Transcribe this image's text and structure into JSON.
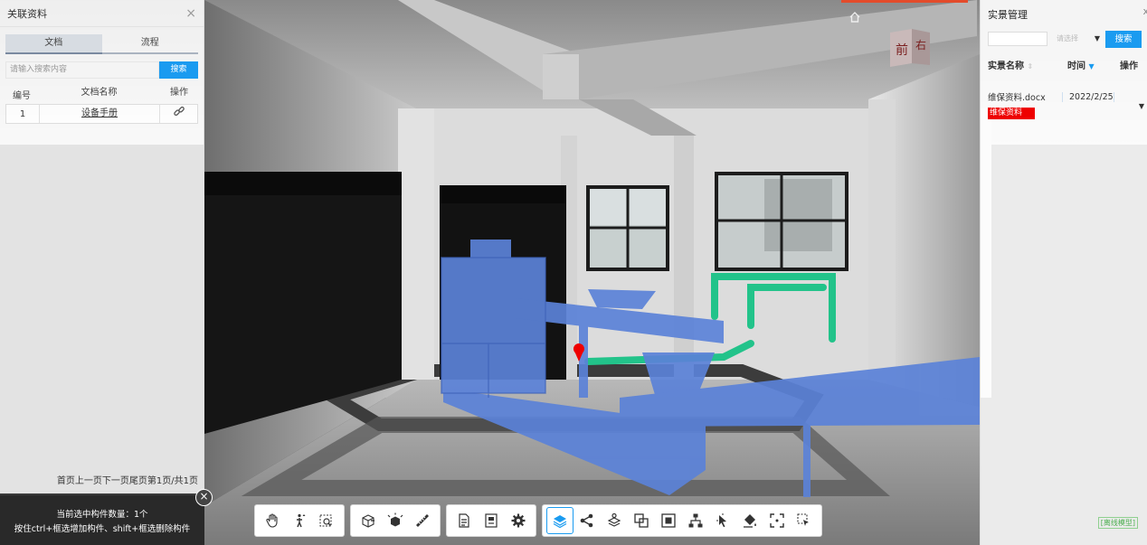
{
  "left_panel": {
    "title": "关联资料",
    "close": "×",
    "tabs": [
      {
        "label": "文档",
        "active": true
      },
      {
        "label": "流程",
        "active": false
      }
    ],
    "search": {
      "placeholder": "请输入搜索内容",
      "button": "搜索"
    },
    "table": {
      "headers": [
        "编号",
        "文档名称",
        "操作"
      ],
      "rows": [
        {
          "no": "1",
          "name": "设备手册",
          "action_icon": "link-icon"
        }
      ]
    },
    "pager": {
      "first": "首页",
      "prev": "上一页",
      "next": "下一页",
      "last": "尾页",
      "info": "第1页/共1页"
    }
  },
  "status": {
    "line1": "当前选中构件数量：1个",
    "line2": "按住ctrl+框选增加构件、shift+框选删除构件",
    "close": "×"
  },
  "right_panel": {
    "title": "实景管理",
    "close": "x",
    "search": {
      "input_value": "",
      "select_placeholder": "请选择",
      "button": "搜索"
    },
    "headers": [
      "实景名称",
      "时间",
      "操作"
    ],
    "rows": [
      {
        "name": "维保资料.docx",
        "time": "2022/2/25"
      }
    ],
    "tag": "维保资料",
    "footer_link": "[离线模型]"
  },
  "nav_cube": {
    "front": "前",
    "right": "右"
  },
  "toolbar": {
    "groups": [
      [
        "pan-hand-icon",
        "walk-person-icon",
        "zoom-extents-icon"
      ],
      [
        "section-box-icon",
        "explode-cube-icon",
        "measure-ruler-icon"
      ],
      [
        "properties-doc-icon",
        "info-panel-icon",
        "settings-gear-icon"
      ],
      [
        "layers-icon",
        "share-icon",
        "tree-layers-icon",
        "overlap-icon",
        "isolate-cube-icon",
        "hierarchy-icon",
        "cursor-move-icon",
        "fill-bucket-icon",
        "frame-select-icon",
        "rotate-select-icon"
      ]
    ],
    "active": "layers-icon"
  },
  "colors": {
    "accent": "#1a9bf0",
    "model_blue": "#5b82d8",
    "pipe_green": "#22c38a",
    "tag_red": "#ee0000"
  }
}
